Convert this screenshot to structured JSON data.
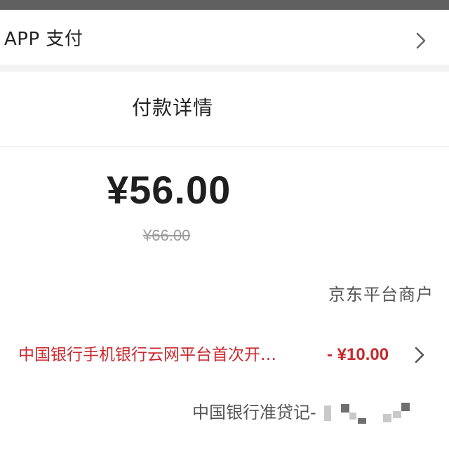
{
  "header": {
    "payment_method": "APP 支付",
    "chevron_icon": "chevron-right-icon"
  },
  "detail": {
    "title": "付款详情",
    "amount": "¥56.00",
    "original_amount": "¥66.00",
    "merchant": "京东平台商户"
  },
  "promotion": {
    "label": "中国银行手机银行云网平台首次开…",
    "discount": "- ¥10.00",
    "chevron_icon": "chevron-right-icon"
  },
  "card": {
    "label": "中国银行准贷记-"
  },
  "colors": {
    "promo_red": "#c8292d",
    "top_bar": "#5f5f5f",
    "secondary_text": "#555555",
    "strike_gray": "#9b9b9b"
  }
}
